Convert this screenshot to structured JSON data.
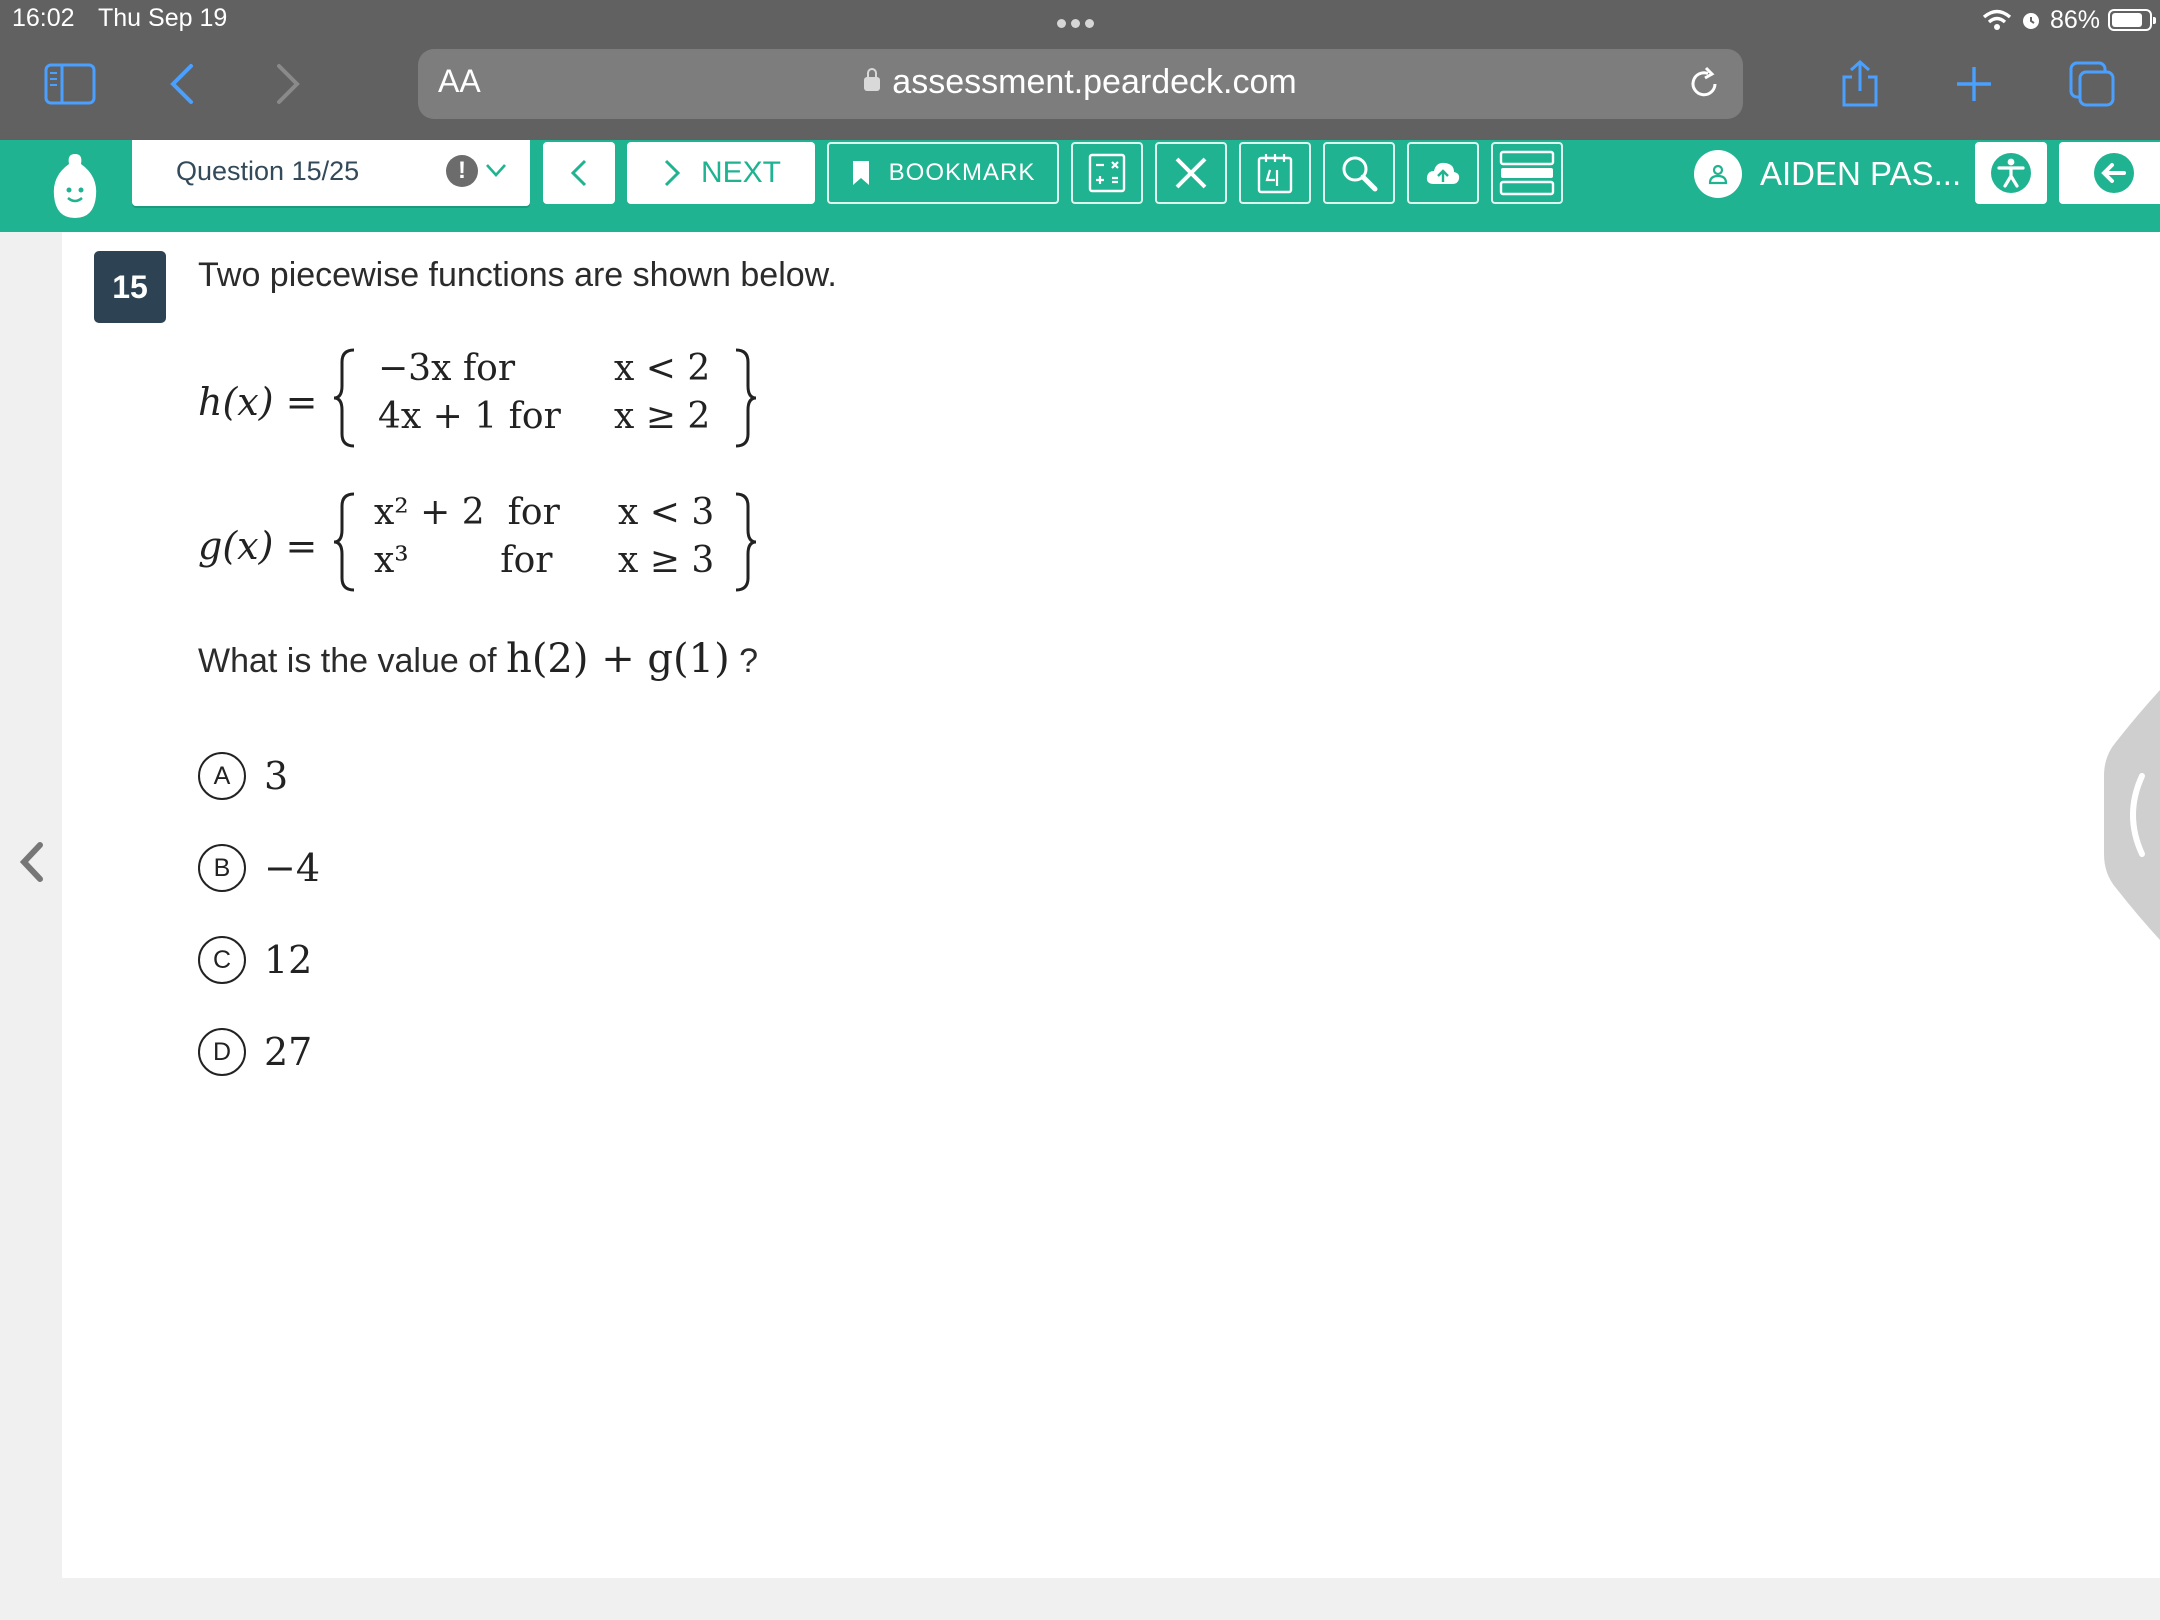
{
  "status_bar": {
    "time": "16:02",
    "date": "Thu Sep 19",
    "battery_text": "86%",
    "battery_level": 0.86
  },
  "browser": {
    "text_size_label": "AA",
    "url": "assessment.peardeck.com",
    "icons": [
      "sidebar-icon",
      "back-icon",
      "forward-icon",
      "reload-icon",
      "share-icon",
      "new-tab-icon",
      "tabs-icon"
    ]
  },
  "toolbar": {
    "question_selector": "Question 15/25",
    "flag_symbol": "!",
    "next_label": "NEXT",
    "bookmark_label": "BOOKMARK",
    "user_name": "AIDEN PAS...",
    "accent_color": "#20b391",
    "tool_icons": [
      "calculator-icon",
      "eliminate-icon",
      "notepad-icon",
      "magnifier-icon",
      "upload-icon",
      "line-reader-icon"
    ]
  },
  "question": {
    "number": "15",
    "prompt": "Two piecewise functions are shown below.",
    "h": {
      "name": "h(x) =",
      "rows": [
        {
          "expr": "−3x for",
          "cond": "x < 2"
        },
        {
          "expr": "4x + 1 for",
          "cond": "x ≥ 2"
        }
      ]
    },
    "g": {
      "name": "g(x) =",
      "rows": [
        {
          "expr": "x² + 2  for",
          "cond": "x < 3"
        },
        {
          "expr": "x³        for",
          "cond": "x ≥ 3"
        }
      ]
    },
    "ask_text": "What is the value of",
    "ask_expr": "h(2) + g(1)",
    "ask_end": "?",
    "options": [
      {
        "letter": "A",
        "value": "3"
      },
      {
        "letter": "B",
        "value": "−4"
      },
      {
        "letter": "C",
        "value": "12"
      },
      {
        "letter": "D",
        "value": "27"
      }
    ]
  }
}
